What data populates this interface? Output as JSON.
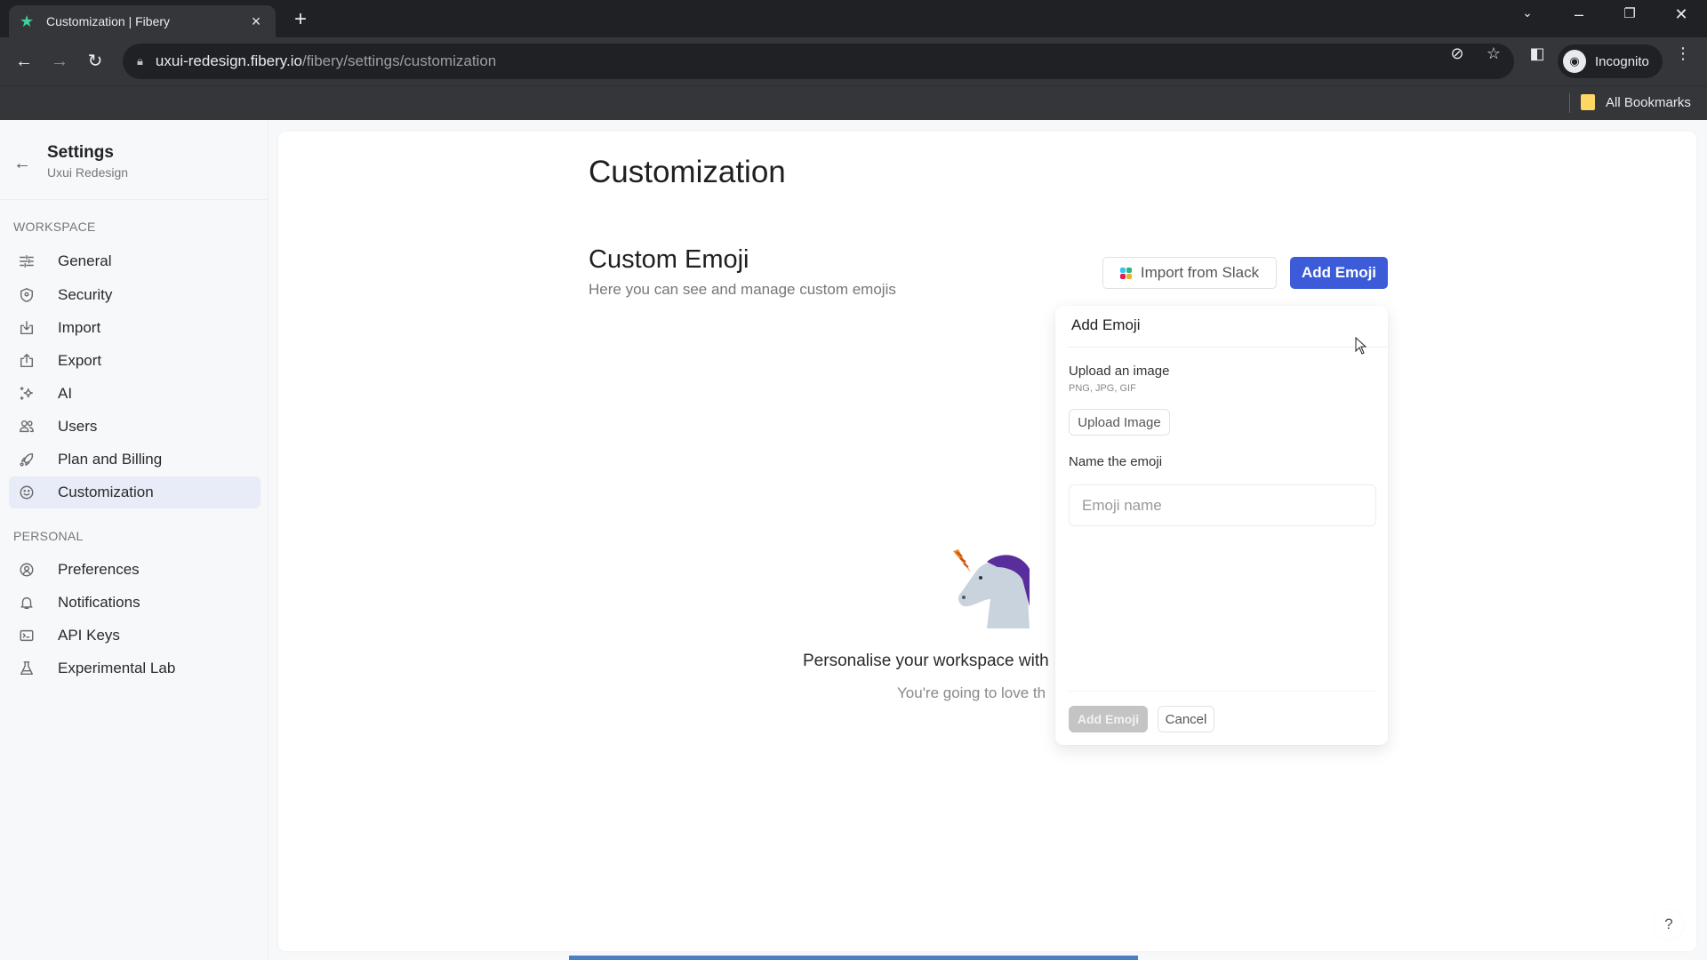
{
  "browser": {
    "tab_title": "Customization | Fibery",
    "url_host": "uxui-redesign.fibery.io",
    "url_path": "/fibery/settings/customization",
    "profile_label": "Incognito",
    "bookmarks_label": "All Bookmarks"
  },
  "sidebar": {
    "title": "Settings",
    "subtitle": "Uxui Redesign",
    "sections": [
      {
        "label": "WORKSPACE",
        "items": [
          {
            "label": "General",
            "icon": "sliders-icon"
          },
          {
            "label": "Security",
            "icon": "shield-icon"
          },
          {
            "label": "Import",
            "icon": "import-icon"
          },
          {
            "label": "Export",
            "icon": "export-icon"
          },
          {
            "label": "AI",
            "icon": "sparkles-icon"
          },
          {
            "label": "Users",
            "icon": "users-icon"
          },
          {
            "label": "Plan and Billing",
            "icon": "rocket-icon"
          },
          {
            "label": "Customization",
            "icon": "smiley-icon",
            "active": true
          }
        ]
      },
      {
        "label": "PERSONAL",
        "items": [
          {
            "label": "Preferences",
            "icon": "user-circle-icon"
          },
          {
            "label": "Notifications",
            "icon": "bell-icon"
          },
          {
            "label": "API Keys",
            "icon": "terminal-icon"
          },
          {
            "label": "Experimental Lab",
            "icon": "flask-icon"
          }
        ]
      }
    ]
  },
  "main": {
    "page_title": "Customization",
    "section_title": "Custom Emoji",
    "section_subtitle": "Here you can see and manage custom emojis",
    "import_button": "Import from Slack",
    "add_button": "Add Emoji",
    "empty_title": "Personalise your workspace with",
    "empty_subtitle": "You're going to love th"
  },
  "popup": {
    "title": "Add Emoji",
    "upload_label": "Upload an image",
    "upload_hint": "PNG, JPG, GIF",
    "upload_button": "Upload Image",
    "name_label": "Name the emoji",
    "name_placeholder": "Emoji name",
    "name_value": "",
    "submit_button": "Add Emoji",
    "cancel_button": "Cancel"
  },
  "help_label": "?",
  "colors": {
    "accent": "#3b5bd9",
    "active_item_bg": "#e8ecf8",
    "disabled_button": "#c4c4c4"
  }
}
